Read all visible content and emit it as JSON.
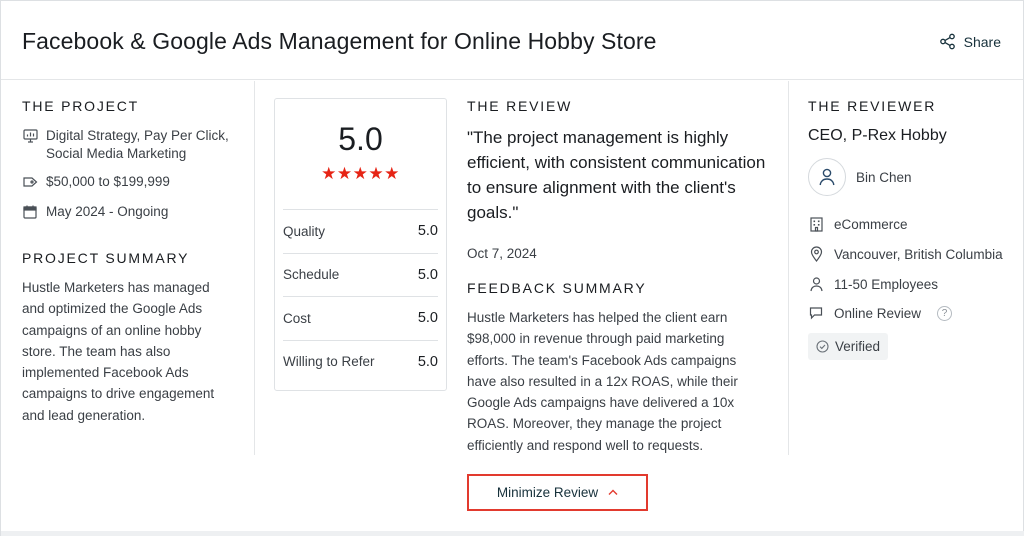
{
  "header": {
    "title": "Facebook & Google Ads Management for Online Hobby Store",
    "share_label": "Share"
  },
  "project": {
    "heading": "THE PROJECT",
    "services": "Digital Strategy, Pay Per Click, Social Media Marketing",
    "budget": "$50,000 to $199,999",
    "timeline": "May 2024 - Ongoing",
    "summary_heading": "PROJECT SUMMARY",
    "summary": "Hustle Marketers has managed and optimized the Google Ads campaigns of an online hobby store. The team has also implemented Facebook Ads campaigns to drive engagement and lead generation."
  },
  "rating": {
    "overall": "5.0",
    "stars": "★★★★★",
    "star_count": 5,
    "rows": [
      {
        "label": "Quality",
        "value": "5.0"
      },
      {
        "label": "Schedule",
        "value": "5.0"
      },
      {
        "label": "Cost",
        "value": "5.0"
      },
      {
        "label": "Willing to Refer",
        "value": "5.0"
      }
    ]
  },
  "review": {
    "heading": "THE REVIEW",
    "quote": "\"The project management is highly efficient, with consistent communication to ensure alignment with the client's goals.\"",
    "date": "Oct 7, 2024",
    "feedback_heading": "FEEDBACK SUMMARY",
    "feedback": "Hustle Marketers has helped the client earn $98,000 in revenue through paid marketing efforts. The team's Facebook Ads campaigns have also resulted in a 12x ROAS, while their Google Ads campaigns have delivered a 10x ROAS. Moreover, they manage the project efficiently and respond well to requests."
  },
  "reviewer": {
    "heading": "THE REVIEWER",
    "title": "CEO, P-Rex Hobby",
    "name": "Bin Chen",
    "industry": "eCommerce",
    "location": "Vancouver, British Columbia",
    "employees": "11-50 Employees",
    "review_type": "Online Review",
    "help_glyph": "?",
    "verified": "Verified"
  },
  "footer": {
    "minimize_label": "Minimize Review"
  },
  "colors": {
    "star": "#e62415",
    "highlight_border": "#e23a2e",
    "text_dark": "#1a1d21",
    "text_body": "#3a3f45",
    "link_navy": "#17313b"
  }
}
